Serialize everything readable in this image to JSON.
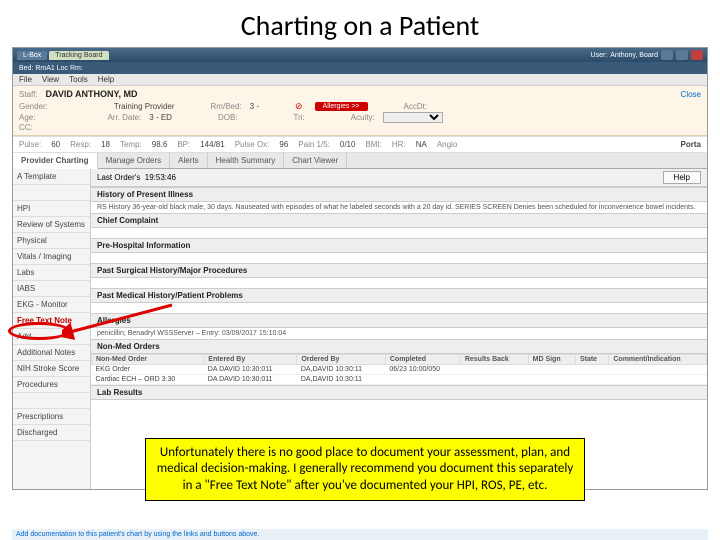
{
  "slide_title": "Charting on a Patient",
  "titlebar": {
    "tabs": [
      "L-Box",
      "Tracking Board"
    ],
    "user_label": "User:",
    "user": "Anthony, Board"
  },
  "toolbar2": {
    "bed_label": "Bed: RmA1 Loc Rm:"
  },
  "menu": {
    "file": "File",
    "view": "View",
    "tools": "Tools",
    "help": "Help"
  },
  "patient": {
    "staff_label": "Staff:",
    "staff": "DAVID ANTHONY, MD",
    "close": "Close",
    "row2": {
      "gender_l": "Gender:",
      "gender": "",
      "tp_l": "Training Provider",
      "rmbed_l": "Rm/Bed:",
      "rmbed": "3 -",
      "allergies": "Allergies >>",
      "accdt_l": "AccDt:"
    },
    "row3": {
      "age_l": "Age:",
      "arrdt_l": "Arr. Date:",
      "arrdt": "3 - ED",
      "dob_l": "DOB:",
      "tri_l": "Tri:",
      "acuity_l": "Acuity:"
    },
    "row4": {
      "cc_l": "CC:"
    }
  },
  "vitals": {
    "pulse_l": "Pulse:",
    "pulse": "60",
    "resp_l": "Resp:",
    "resp": "18",
    "temp_l": "Temp:",
    "temp": "98.6",
    "bp_l": "BP:",
    "bp": "144/81",
    "pox_l": "Pulse Ox:",
    "pox": "96",
    "pain_l": "Pain 1/5:",
    "pain": "0/10",
    "bmi_l": "BMI:",
    "bmi": "",
    "hr_l": "HR:",
    "hr": "NA",
    "angio_l": "Angio",
    "porta": "Porta"
  },
  "tabs": {
    "t1": "Provider Charting",
    "t2": "Manage Orders",
    "t3": "Alerts",
    "t4": "Health Summary",
    "t5": "Chart Viewer"
  },
  "subhead": {
    "label": "Last Order's",
    "ts": "19:53:46",
    "help": "Help"
  },
  "sidebar": {
    "items": [
      "A Template",
      "",
      "HPI",
      "Review of Systems",
      "Physical",
      "Vitals / Imaging",
      "Labs",
      "IABS",
      "EKG - Monitor",
      "Free Text Note",
      "Add",
      "Additional Notes",
      "NIH Stroke Score",
      "Procedures",
      "",
      "Prescriptions",
      "Discharged"
    ],
    "highlight_index": 9
  },
  "sections": {
    "hpi_h": "History of Present Illness",
    "hpi_t": "RS History 36-year-old black male, 30 days. Nauseated with episodes of what he labeled seconds with a 20 day id. SERIES SCREEN Denies been scheduled for inconvenience bowel incidents.",
    "cc_h": "Chief Complaint",
    "prehosp_h": "Pre-Hospital Information",
    "psh_h": "Past Surgical History/Major Procedures",
    "pmh_h": "Past Medical History/Patient Problems",
    "allergy_h": "Allergies",
    "allergy_t": "penicillin; Benadryl WSSServer – Entry: 03/09/2017 15:10:04",
    "nonmed_h": "Non-Med Orders",
    "lab_h": "Lab Results"
  },
  "orders": {
    "headers": [
      "Non-Med Order",
      "Entered By",
      "Ordered By",
      "Completed",
      "Results Back",
      "MD Sign",
      "State",
      "Comment/Indication"
    ],
    "rows": [
      {
        "o": "EKG Order",
        "e": "DA DAVID 10:30:011",
        "b": "DA,DAVID 10:30:11",
        "c": "06/23 10:00/050",
        "r": "",
        "m": "",
        "s": "",
        "ci": ""
      },
      {
        "o": "Cardiac ECH – ORD 3:30",
        "e": "DA DAVID 10:30:011",
        "b": "DA,DAVID 10:30:11",
        "c": "",
        "r": "",
        "m": "",
        "s": "",
        "ci": ""
      }
    ]
  },
  "footer": "Add documentation to this patient's chart by using the links and buttons above.",
  "callout": "Unfortunately there is no good place to document your assessment, plan, and medical decision-making. I generally recommend you document this separately in a \"Free Text Note\" after you've documented your HPI, ROS, PE, etc."
}
